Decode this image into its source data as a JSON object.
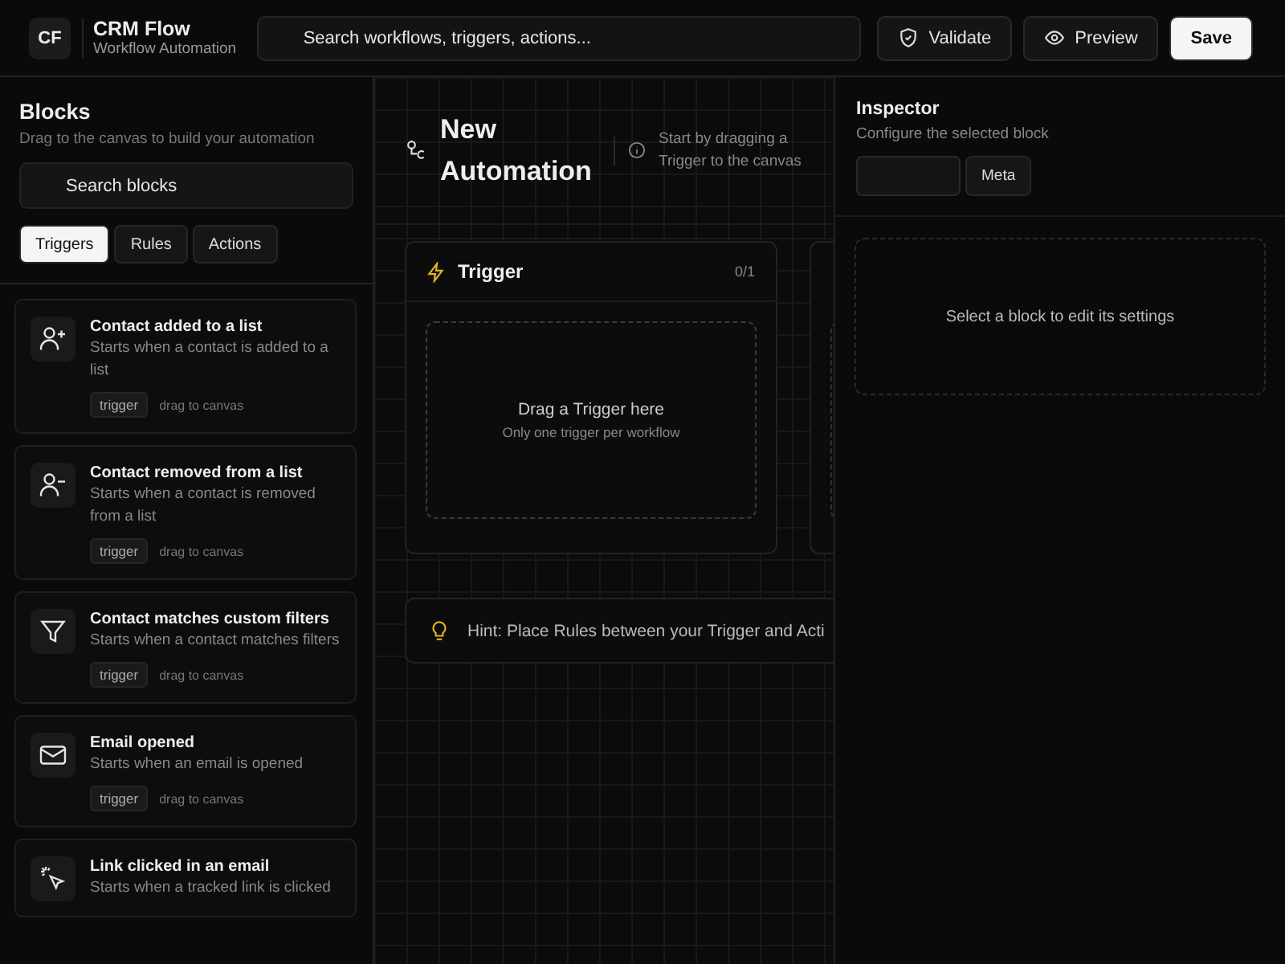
{
  "app": {
    "logo": "CF",
    "name": "CRM Flow",
    "subtitle": "Workflow Automation"
  },
  "search": {
    "placeholder": "Search workflows, triggers, actions..."
  },
  "header_buttons": [
    {
      "label": "Validate",
      "kind": "validate"
    },
    {
      "label": "Preview",
      "kind": "preview"
    },
    {
      "label": "Save",
      "kind": "primary"
    }
  ],
  "sidebar": {
    "title": "Blocks",
    "subtitle": "Drag to the canvas to build your automation",
    "search": {
      "placeholder": "Search blocks"
    },
    "tabs": [
      {
        "label": "Triggers",
        "selected": true
      },
      {
        "label": "Rules",
        "selected": false
      },
      {
        "label": "Actions",
        "selected": false
      }
    ],
    "items": [
      {
        "kind": "user-plus",
        "title": "Contact added to a list",
        "description": "Starts when a contact is added to a list",
        "tag": "trigger",
        "hint": "drag to canvas"
      },
      {
        "kind": "user-minus",
        "title": "Contact removed from a list",
        "description": "Starts when a contact is removed from a list",
        "tag": "trigger",
        "hint": "drag to canvas"
      },
      {
        "kind": "filter",
        "title": "Contact matches custom filters",
        "description": "Starts when a contact matches filters",
        "tag": "trigger",
        "hint": "drag to canvas"
      },
      {
        "kind": "mail",
        "title": "Email opened",
        "description": "Starts when an email is opened",
        "tag": "trigger",
        "hint": "drag to canvas"
      },
      {
        "kind": "pointer",
        "title": "Link clicked in an email",
        "description": "Starts when a tracked link is clicked"
      }
    ]
  },
  "canvas": {
    "title": "New Automation",
    "info": "Start by dragging a Trigger to the canvas",
    "trigger_card": {
      "title": "Trigger",
      "count": "0/1",
      "drop_title": "Drag a Trigger here",
      "drop_hint": "Only one trigger per workflow"
    },
    "hint": "Hint: Place Rules between your Trigger and Acti"
  },
  "inspector": {
    "title": "Inspector",
    "subtitle": "Configure the selected block",
    "meta_button": "Meta",
    "empty": "Select a block to edit its settings"
  }
}
